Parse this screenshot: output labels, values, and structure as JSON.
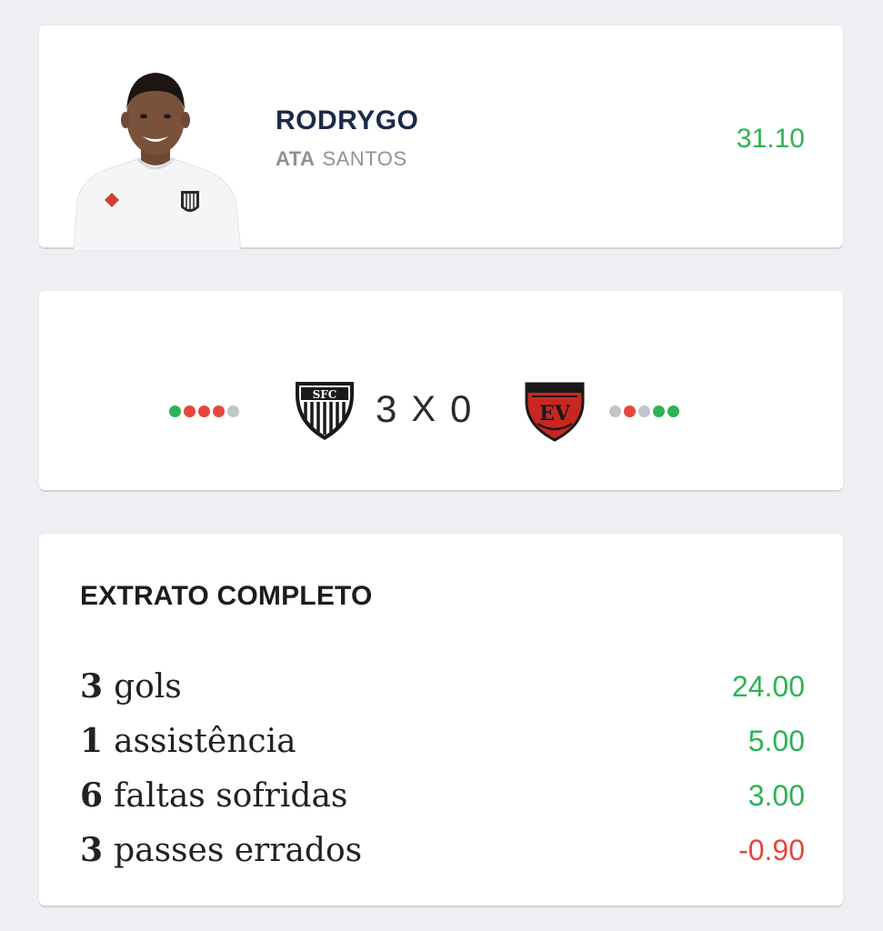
{
  "player": {
    "name": "RODRYGO",
    "position": "ATA",
    "team": "SANTOS",
    "score": "31.10",
    "score_color": "#2db354"
  },
  "match": {
    "home_score": "3",
    "separator": "X",
    "away_score": "0",
    "home_form": [
      "green",
      "red",
      "red",
      "red",
      "gray"
    ],
    "away_form": [
      "gray",
      "red",
      "gray",
      "green",
      "green"
    ],
    "colors": {
      "green": "#2db354",
      "red": "#e5463d",
      "gray": "#c3c5cb"
    },
    "home_crest_icon": "santos-crest-icon",
    "away_crest_icon": "vitoria-crest-icon"
  },
  "extract": {
    "title": "EXTRATO COMPLETO",
    "items": [
      {
        "qty": "3",
        "label": "gols",
        "value": "24.00",
        "color": "#2db354"
      },
      {
        "qty": "1",
        "label": "assistência",
        "value": "5.00",
        "color": "#2db354"
      },
      {
        "qty": "6",
        "label": "faltas sofridas",
        "value": "3.00",
        "color": "#2db354"
      },
      {
        "qty": "3",
        "label": "passes errados",
        "value": "-0.90",
        "color": "#e5463d"
      }
    ]
  }
}
